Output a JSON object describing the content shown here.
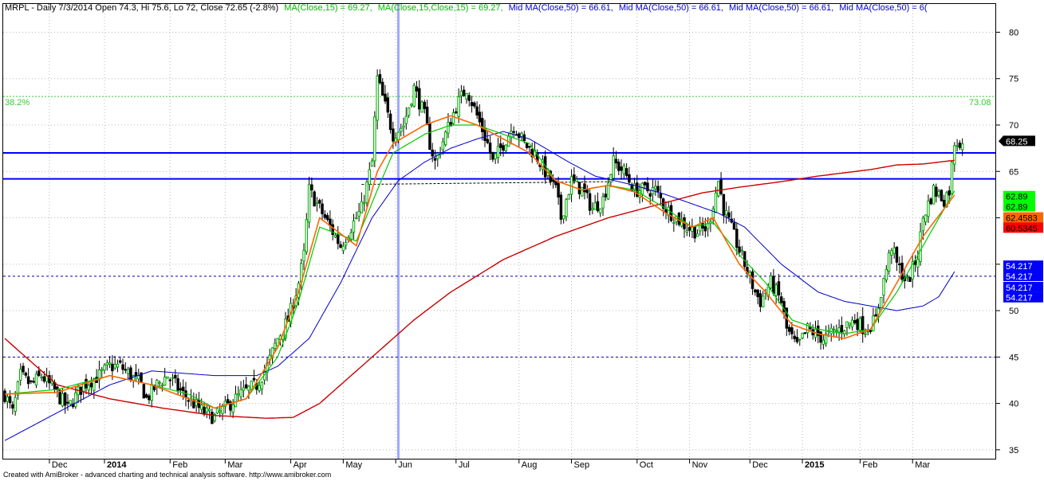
{
  "header": {
    "ticker": "MRPL - Daily 7/3/2014 Open 74.3, Hi 75.6, Lo 72, Close 72.65 (-2.8%)",
    "ma15": "MA(Close,15) = 69.27,",
    "ma15b": "MA(Close,15,Close,15) = 69.27,",
    "mid1": "Mid MA(Close,50) = 66.61,",
    "mid2": "Mid MA(Close,50) = 66.61,",
    "mid3": "Mid MA(Close,50) = 66.61,",
    "mid4": "Mid MA(Close,50) = 6("
  },
  "footer": "Created with AmiBroker - advanced charting and technical analysis software. http://www.amibroker.com",
  "colors": {
    "up": "#00aa00",
    "down": "#000000",
    "ma15_green": "#00cc00",
    "ema_orange": "#ff6600",
    "ma50_blue": "#0000cc",
    "ma200_red": "#cc0000",
    "hline": "#0000ff",
    "fib": "#33cc33"
  },
  "chart_data": {
    "type": "candlestick",
    "y_range": [
      34,
      83
    ],
    "y_ticks": [
      "35",
      "40",
      "45",
      "50",
      "55",
      "60",
      "65",
      "70",
      "75",
      "80"
    ],
    "x_labels": [
      "Dec",
      "2014",
      "Feb",
      "Mar",
      "Apr",
      "May",
      "Jun",
      "Jul",
      "Aug",
      "Sep",
      "Oct",
      "Nov",
      "Dec",
      "2015",
      "Feb",
      "Mar"
    ],
    "fib_label": "38.2%",
    "fib_value": "73.08",
    "fib_level": 73.08,
    "horizontal_lines": [
      67.0,
      64.2
    ],
    "dashed_levels": [
      53.7,
      45.0
    ],
    "value_tags": [
      {
        "text": "68.25",
        "value": 68.25,
        "bg": "#000000",
        "fg": "#ffffff"
      },
      {
        "text": "62.89",
        "value": 62.3,
        "bg": "#00ff00",
        "fg": "#000000"
      },
      {
        "text": "62.89",
        "value": 61.2,
        "bg": "#00ff00",
        "fg": "#000000"
      },
      {
        "text": "62.4583",
        "value": 60.0,
        "bg": "#ff6600",
        "fg": "#000000"
      },
      {
        "text": "60.5345",
        "value": 58.9,
        "bg": "#ff0000",
        "fg": "#000000"
      },
      {
        "text": "54.217",
        "value": 54.8,
        "bg": "#0000ff",
        "fg": "#ffffff"
      },
      {
        "text": "54.217",
        "value": 53.7,
        "bg": "#0000ff",
        "fg": "#ffffff"
      },
      {
        "text": "54.217",
        "value": 52.5,
        "bg": "#0000ff",
        "fg": "#ffffff"
      },
      {
        "text": "54.217",
        "value": 51.4,
        "bg": "#0000ff",
        "fg": "#ffffff"
      }
    ],
    "price_anchors": [
      [
        0,
        41
      ],
      [
        3,
        39
      ],
      [
        6,
        43
      ],
      [
        10,
        42
      ],
      [
        14,
        43
      ],
      [
        20,
        41
      ],
      [
        24,
        39.5
      ],
      [
        30,
        42
      ],
      [
        36,
        43
      ],
      [
        40,
        44
      ],
      [
        44,
        44
      ],
      [
        48,
        43
      ],
      [
        52,
        42
      ],
      [
        54,
        40.5
      ],
      [
        58,
        42
      ],
      [
        62,
        43
      ],
      [
        68,
        41
      ],
      [
        72,
        40
      ],
      [
        76,
        39
      ],
      [
        80,
        38.5
      ],
      [
        84,
        39.5
      ],
      [
        90,
        41
      ],
      [
        96,
        42
      ],
      [
        100,
        44
      ],
      [
        104,
        47
      ],
      [
        108,
        49
      ],
      [
        112,
        53
      ],
      [
        114,
        56
      ],
      [
        116,
        63
      ],
      [
        120,
        61
      ],
      [
        124,
        59
      ],
      [
        128,
        57
      ],
      [
        132,
        59
      ],
      [
        136,
        61
      ],
      [
        140,
        66
      ],
      [
        142,
        75
      ],
      [
        145,
        72
      ],
      [
        148,
        69
      ],
      [
        152,
        70
      ],
      [
        156,
        74
      ],
      [
        160,
        71
      ],
      [
        162,
        68
      ],
      [
        164,
        66
      ],
      [
        168,
        69
      ],
      [
        172,
        72
      ],
      [
        176,
        74
      ],
      [
        180,
        71
      ],
      [
        184,
        68
      ],
      [
        186,
        66
      ],
      [
        190,
        68
      ],
      [
        194,
        70
      ],
      [
        198,
        68
      ],
      [
        202,
        67
      ],
      [
        206,
        65
      ],
      [
        210,
        63
      ],
      [
        212,
        60
      ],
      [
        216,
        64
      ],
      [
        220,
        63
      ],
      [
        224,
        61
      ],
      [
        228,
        62
      ],
      [
        232,
        66
      ],
      [
        236,
        65
      ],
      [
        240,
        63
      ],
      [
        244,
        63
      ],
      [
        248,
        63
      ],
      [
        252,
        61
      ],
      [
        256,
        60
      ],
      [
        260,
        59
      ],
      [
        264,
        58.5
      ],
      [
        268,
        59
      ],
      [
        272,
        64
      ],
      [
        274,
        61
      ],
      [
        278,
        58
      ],
      [
        282,
        55
      ],
      [
        286,
        52
      ],
      [
        288,
        51
      ],
      [
        292,
        53
      ],
      [
        296,
        51
      ],
      [
        298,
        48
      ],
      [
        302,
        46
      ],
      [
        306,
        48
      ],
      [
        312,
        47
      ],
      [
        318,
        48
      ],
      [
        324,
        49
      ],
      [
        328,
        48
      ],
      [
        332,
        49
      ],
      [
        334,
        52
      ],
      [
        338,
        57
      ],
      [
        340,
        55
      ],
      [
        344,
        53
      ],
      [
        348,
        56
      ],
      [
        350,
        60
      ],
      [
        354,
        63
      ],
      [
        358,
        62
      ],
      [
        360,
        63
      ],
      [
        362,
        68.25
      ]
    ],
    "ma15_anchors": [
      [
        0,
        41
      ],
      [
        20,
        41.5
      ],
      [
        40,
        43
      ],
      [
        56,
        42
      ],
      [
        70,
        41
      ],
      [
        80,
        39.5
      ],
      [
        92,
        40.5
      ],
      [
        104,
        45
      ],
      [
        112,
        51
      ],
      [
        120,
        59
      ],
      [
        134,
        57.5
      ],
      [
        142,
        63
      ],
      [
        148,
        67
      ],
      [
        160,
        69
      ],
      [
        170,
        70
      ],
      [
        180,
        70
      ],
      [
        190,
        69
      ],
      [
        200,
        68
      ],
      [
        210,
        64
      ],
      [
        220,
        63
      ],
      [
        230,
        63.5
      ],
      [
        240,
        63
      ],
      [
        252,
        61
      ],
      [
        262,
        59
      ],
      [
        270,
        59.5
      ],
      [
        280,
        56
      ],
      [
        290,
        53
      ],
      [
        300,
        49
      ],
      [
        310,
        48
      ],
      [
        320,
        47.5
      ],
      [
        330,
        48
      ],
      [
        340,
        52
      ],
      [
        350,
        57
      ],
      [
        362,
        62.9
      ]
    ],
    "ema_anchors": [
      [
        0,
        41
      ],
      [
        20,
        41.2
      ],
      [
        40,
        43
      ],
      [
        56,
        42
      ],
      [
        70,
        40.5
      ],
      [
        80,
        39.5
      ],
      [
        92,
        40.5
      ],
      [
        104,
        46
      ],
      [
        112,
        52
      ],
      [
        120,
        60
      ],
      [
        134,
        57
      ],
      [
        142,
        65
      ],
      [
        148,
        68
      ],
      [
        160,
        70
      ],
      [
        170,
        71
      ],
      [
        180,
        70
      ],
      [
        190,
        68.5
      ],
      [
        200,
        67
      ],
      [
        210,
        64
      ],
      [
        220,
        63
      ],
      [
        230,
        63.5
      ],
      [
        240,
        62.8
      ],
      [
        252,
        60.5
      ],
      [
        262,
        59
      ],
      [
        270,
        60
      ],
      [
        280,
        55
      ],
      [
        290,
        52
      ],
      [
        300,
        48.5
      ],
      [
        310,
        47.5
      ],
      [
        320,
        47
      ],
      [
        330,
        48
      ],
      [
        340,
        53
      ],
      [
        350,
        58
      ],
      [
        362,
        62.46
      ]
    ],
    "ma50_anchors": [
      [
        0,
        36
      ],
      [
        20,
        39
      ],
      [
        40,
        42
      ],
      [
        56,
        43.5
      ],
      [
        80,
        43
      ],
      [
        96,
        43
      ],
      [
        104,
        44
      ],
      [
        116,
        47
      ],
      [
        128,
        53
      ],
      [
        140,
        60
      ],
      [
        150,
        64
      ],
      [
        160,
        66
      ],
      [
        170,
        67.5
      ],
      [
        180,
        68.5
      ],
      [
        190,
        69.3
      ],
      [
        200,
        68.5
      ],
      [
        215,
        66
      ],
      [
        225,
        64.5
      ],
      [
        240,
        63.5
      ],
      [
        252,
        62.5
      ],
      [
        262,
        61.5
      ],
      [
        272,
        60.5
      ],
      [
        282,
        59
      ],
      [
        296,
        55
      ],
      [
        310,
        52
      ],
      [
        320,
        51
      ],
      [
        330,
        50.5
      ],
      [
        340,
        50
      ],
      [
        350,
        50.5
      ],
      [
        356,
        51.5
      ],
      [
        362,
        54.2
      ]
    ],
    "ma200_anchors": [
      [
        0,
        47
      ],
      [
        20,
        42
      ],
      [
        40,
        40.5
      ],
      [
        60,
        39.5
      ],
      [
        80,
        38.7
      ],
      [
        100,
        38.4
      ],
      [
        110,
        38.5
      ],
      [
        120,
        40
      ],
      [
        132,
        43
      ],
      [
        144,
        46
      ],
      [
        156,
        49
      ],
      [
        170,
        52
      ],
      [
        190,
        55.5
      ],
      [
        210,
        58
      ],
      [
        230,
        60
      ],
      [
        250,
        61.5
      ],
      [
        266,
        62.7
      ],
      [
        280,
        63.3
      ],
      [
        296,
        63.9
      ],
      [
        310,
        64.5
      ],
      [
        330,
        65.2
      ],
      [
        340,
        65.7
      ],
      [
        350,
        65.8
      ],
      [
        362,
        66.2
      ]
    ],
    "x_label_bars": [
      17,
      38,
      63,
      84,
      109,
      129,
      149,
      172,
      196,
      216,
      241,
      261,
      284,
      304,
      326,
      346
    ]
  }
}
